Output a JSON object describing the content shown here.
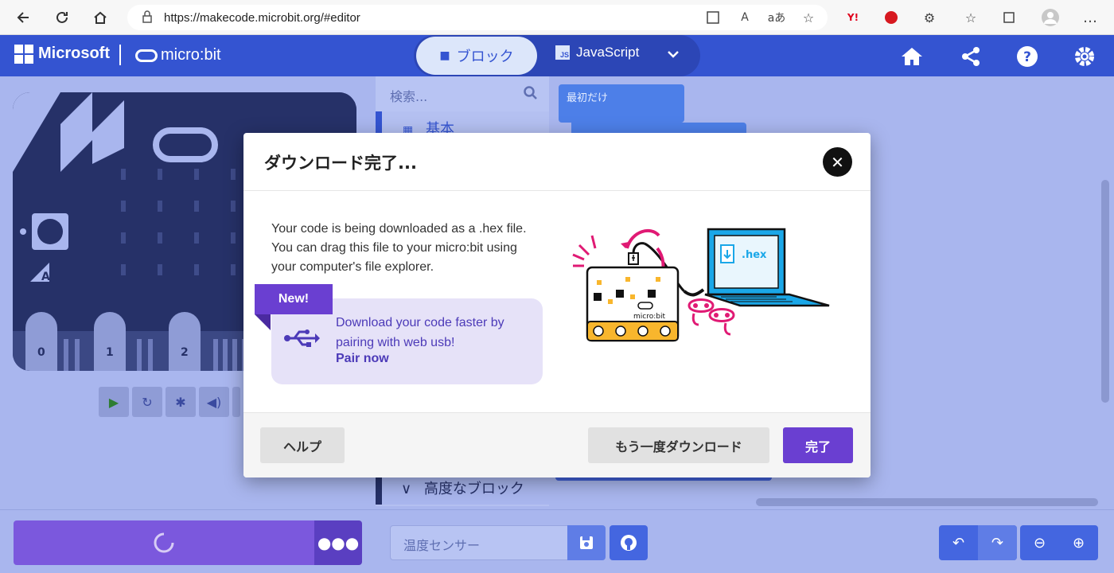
{
  "browser": {
    "url": "https://makecode.microbit.org/#editor"
  },
  "header": {
    "brand": "Microsoft",
    "product": "micro:bit",
    "tabs": [
      {
        "label": "ブロック",
        "selected": true
      },
      {
        "label": "JavaScript",
        "selected": false
      }
    ],
    "icons": [
      "home-icon",
      "share-icon",
      "help-icon",
      "settings-icon"
    ]
  },
  "toolbox": {
    "search_placeholder": "検索...",
    "categories": [
      "基本",
      "高度なブロック"
    ]
  },
  "workspace": {
    "block_on_start": "最初だけ"
  },
  "simulator": {
    "pins": [
      "0",
      "1",
      "2"
    ],
    "button_a": "A"
  },
  "bottom": {
    "project_name": "温度センサー"
  },
  "dialog": {
    "title": "ダウンロード完了...",
    "message": "Your code is being downloaded as a .hex file. You can drag this file to your micro:bit using your computer's file explorer.",
    "new_badge": "New!",
    "new_message": "Download your code faster by pairing with web usb!",
    "pair_link": "Pair now",
    "illustration_hex": ".hex",
    "illustration_board": "micro:bit",
    "help_label": "ヘルプ",
    "redownload_label": "もう一度ダウンロード",
    "done_label": "完了"
  },
  "colors": {
    "accent_blue": "#3454d1",
    "purple": "#6a3fd1",
    "overlay_blue": "#a9b6ee"
  }
}
